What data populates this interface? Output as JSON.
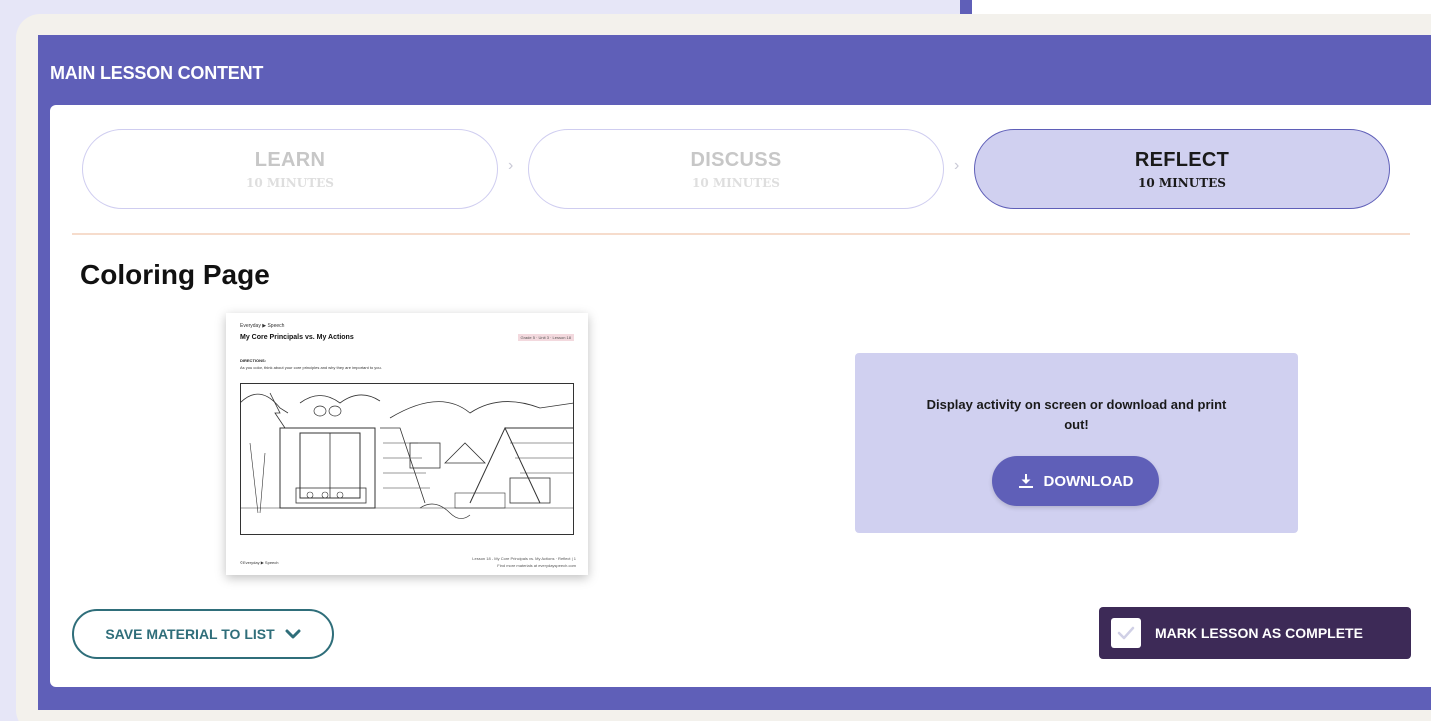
{
  "panel": {
    "title": "MAIN LESSON CONTENT"
  },
  "steps": [
    {
      "label": "LEARN",
      "duration": "10 MINUTES",
      "active": false
    },
    {
      "label": "DISCUSS",
      "duration": "10 MINUTES",
      "active": false
    },
    {
      "label": "REFLECT",
      "duration": "10 MINUTES",
      "active": true
    }
  ],
  "section": {
    "title": "Coloring Page"
  },
  "worksheet": {
    "brand": "Everyday ▶ Speech",
    "title": "My Core Principals vs. My Actions",
    "tag": "Grade 5 · Unit 3 · Lesson 18",
    "directions_heading": "DIRECTIONS:",
    "directions": "As you color, think about your core principles and why they are important to you.",
    "footer_left": "©Everyday ▶ Speech",
    "footer_right_1": "Lesson 18 - My Core Principals vs. My Actions · Reflect | 1",
    "footer_right_2": "Find more materials at everydayspeech.com"
  },
  "download": {
    "text": "Display activity on screen or download and print out!",
    "button_label": "DOWNLOAD",
    "icon": "download-icon"
  },
  "actions": {
    "save_label": "SAVE MATERIAL TO LIST",
    "complete_label": "MARK LESSON AS COMPLETE"
  },
  "colors": {
    "primary": "#5f5fb8",
    "active_step_bg": "#d0d0f0",
    "dark_button": "#3d2a57",
    "teal": "#2f6e7a",
    "divider": "#f6dccc"
  }
}
